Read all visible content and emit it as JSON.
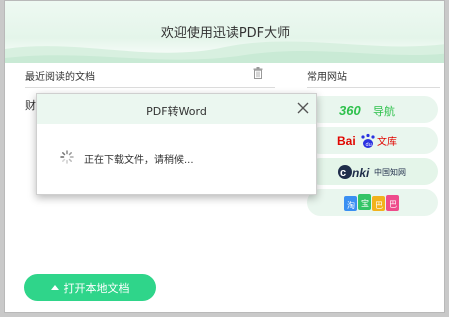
{
  "app": {
    "title": "欢迎使用迅读PDF大师"
  },
  "recent_docs": {
    "heading": "最近阅读的文档",
    "first_item_partial": "财",
    "delete_icon": "trash-icon"
  },
  "websites": {
    "heading": "常用网站",
    "items": [
      {
        "label": "360导航",
        "logo": "360-logo"
      },
      {
        "label": "Bai文库",
        "logo": "baidu-wenku-logo"
      },
      {
        "label": "cnki中国知网",
        "logo": "cnki-logo"
      },
      {
        "label": "淘宝巴巴",
        "logo": "colorful-blocks-logo"
      }
    ]
  },
  "open_button": {
    "label": "打开本地文档",
    "icon": "upload-arrow-icon"
  },
  "dialog": {
    "title": "PDF转Word",
    "message": "正在下载文件，请稍候...",
    "close_icon": "close-icon",
    "spinner_icon": "loading-spinner-icon"
  },
  "colors": {
    "accent": "#2fd58a",
    "header_bg": "#e4f5ea",
    "site_pill_bg": "#e9f6ee"
  }
}
